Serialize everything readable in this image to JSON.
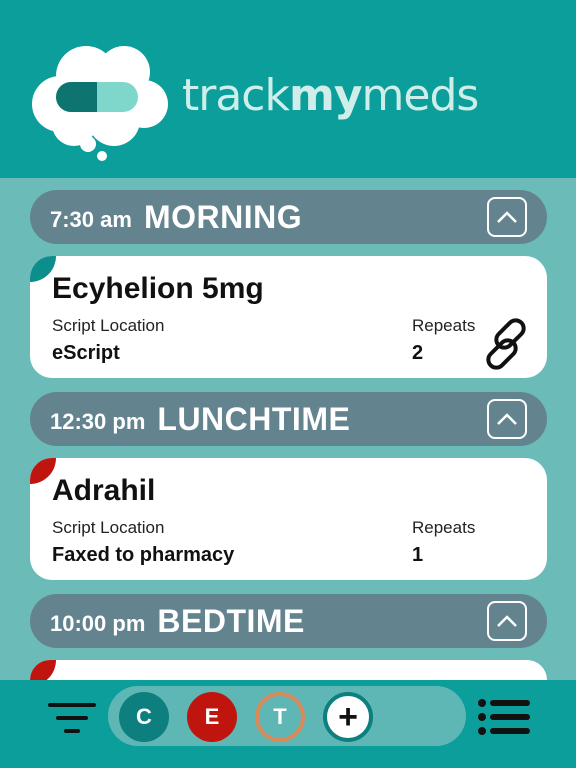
{
  "app": {
    "brand_part1": "track",
    "brand_part2": "my",
    "brand_part3": "meds"
  },
  "sections": [
    {
      "time": "7:30 am",
      "label": "MORNING",
      "collapse_icon": "chevron-up-icon",
      "meds": [
        {
          "name": "Ecyhelion 5mg",
          "location_label": "Script Location",
          "location_value": "eScript",
          "repeats_label": "Repeats",
          "repeats_value": "2",
          "flag_color": "#0c8f8c",
          "icon": "link-icon"
        }
      ]
    },
    {
      "time": "12:30 pm",
      "label": "LUNCHTIME",
      "collapse_icon": "chevron-up-icon",
      "meds": [
        {
          "name": "Adrahil",
          "location_label": "Script Location",
          "location_value": "Faxed to pharmacy",
          "repeats_label": "Repeats",
          "repeats_value": "1",
          "flag_color": "#c0150f"
        }
      ]
    },
    {
      "time": "10:00 pm",
      "label": "BEDTIME",
      "collapse_icon": "chevron-up-icon",
      "meds": []
    }
  ],
  "footer": {
    "filter_icon": "filter-icon",
    "list_icon": "list-menu-icon",
    "buttons": [
      {
        "label": "C",
        "color": "#0c7f7e"
      },
      {
        "label": "E",
        "color": "#c0150f"
      },
      {
        "label": "T",
        "color": "#d98a5a"
      },
      {
        "label": "+",
        "color": "#0c7f7e"
      }
    ]
  },
  "colors": {
    "header_bg": "#0c9e9b",
    "content_bg": "#6bbbb8",
    "section_bar": "#63848f"
  }
}
